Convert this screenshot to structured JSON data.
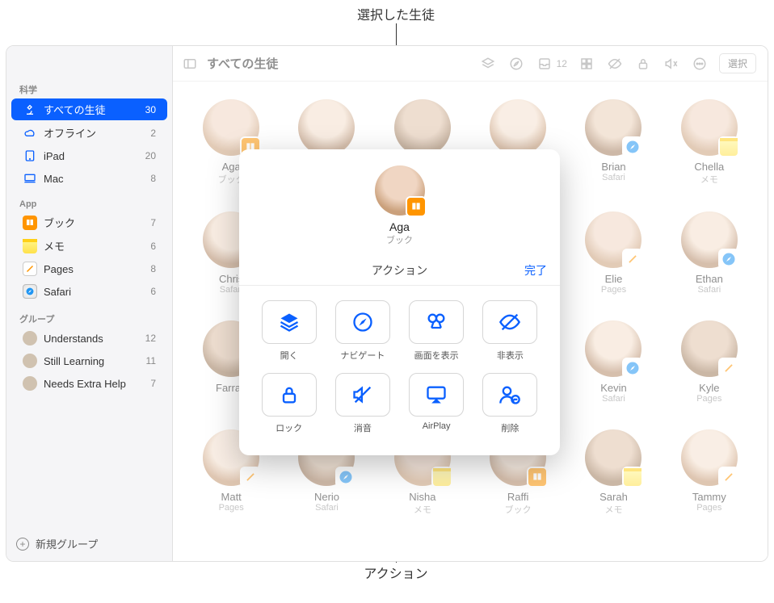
{
  "callouts": {
    "top": "選択した生徒",
    "bottom": "アクション"
  },
  "toolbar": {
    "title": "すべての生徒",
    "inbox_count": "12",
    "select": "選択"
  },
  "sidebar": {
    "section_class": "科学",
    "class_items": [
      {
        "label": "すべての生徒",
        "count": "30",
        "icon": "microscope"
      },
      {
        "label": "オフライン",
        "count": "2",
        "icon": "cloud"
      },
      {
        "label": "iPad",
        "count": "20",
        "icon": "ipad"
      },
      {
        "label": "Mac",
        "count": "8",
        "icon": "mac"
      }
    ],
    "section_app": "App",
    "app_items": [
      {
        "label": "ブック",
        "count": "7",
        "icon": "books"
      },
      {
        "label": "メモ",
        "count": "6",
        "icon": "notes"
      },
      {
        "label": "Pages",
        "count": "8",
        "icon": "pages"
      },
      {
        "label": "Safari",
        "count": "6",
        "icon": "safari"
      }
    ],
    "section_group": "グループ",
    "group_items": [
      {
        "label": "Understands",
        "count": "12"
      },
      {
        "label": "Still Learning",
        "count": "11"
      },
      {
        "label": "Needs Extra Help",
        "count": "7"
      }
    ],
    "new_group": "新規グループ"
  },
  "students": [
    {
      "name": "Aga",
      "sub": "ブック",
      "badge": "books",
      "av": "av2"
    },
    {
      "name": "",
      "sub": "",
      "badge": "",
      "av": "av3"
    },
    {
      "name": "",
      "sub": "",
      "badge": "",
      "av": "av4"
    },
    {
      "name": "",
      "sub": "",
      "badge": "",
      "av": "av5"
    },
    {
      "name": "Brian",
      "sub": "Safari",
      "badge": "safari",
      "av": "av6"
    },
    {
      "name": "Chella",
      "sub": "メモ",
      "badge": "notes",
      "av": "av2"
    },
    {
      "name": "Chris",
      "sub": "Safari",
      "badge": "safari",
      "av": "av3"
    },
    {
      "name": "",
      "sub": "",
      "badge": "",
      "av": "av4"
    },
    {
      "name": "",
      "sub": "",
      "badge": "",
      "av": "av5"
    },
    {
      "name": "",
      "sub": "",
      "badge": "",
      "av": "av6"
    },
    {
      "name": "Elie",
      "sub": "Pages",
      "badge": "pages",
      "av": "av2"
    },
    {
      "name": "Ethan",
      "sub": "Safari",
      "badge": "safari",
      "av": "av3"
    },
    {
      "name": "Farrah",
      "sub": "",
      "badge": "",
      "av": "av4"
    },
    {
      "name": "",
      "sub": "",
      "badge": "",
      "av": "av5"
    },
    {
      "name": "",
      "sub": "",
      "badge": "",
      "av": "av6"
    },
    {
      "name": "",
      "sub": "",
      "badge": "",
      "av": "av2"
    },
    {
      "name": "Kevin",
      "sub": "Safari",
      "badge": "safari",
      "av": "av3"
    },
    {
      "name": "Kyle",
      "sub": "Pages",
      "badge": "pages",
      "av": "av4"
    },
    {
      "name": "Matt",
      "sub": "Pages",
      "badge": "pages",
      "av": "av5"
    },
    {
      "name": "Nerio",
      "sub": "Safari",
      "badge": "safari",
      "av": "av6"
    },
    {
      "name": "Nisha",
      "sub": "メモ",
      "badge": "notes",
      "av": "av2"
    },
    {
      "name": "Raffi",
      "sub": "ブック",
      "badge": "books",
      "av": "av3"
    },
    {
      "name": "Sarah",
      "sub": "メモ",
      "badge": "notes",
      "av": "av4"
    },
    {
      "name": "Tammy",
      "sub": "Pages",
      "badge": "pages",
      "av": "av5"
    }
  ],
  "popover": {
    "name": "Aga",
    "sub": "ブック",
    "title": "アクション",
    "done": "完了",
    "actions": [
      {
        "label": "開く",
        "icon": "open"
      },
      {
        "label": "ナビゲート",
        "icon": "navigate"
      },
      {
        "label": "画面を表示",
        "icon": "screens"
      },
      {
        "label": "非表示",
        "icon": "hide"
      },
      {
        "label": "ロック",
        "icon": "lock"
      },
      {
        "label": "消音",
        "icon": "mute"
      },
      {
        "label": "AirPlay",
        "icon": "airplay"
      },
      {
        "label": "削除",
        "icon": "remove"
      }
    ]
  }
}
